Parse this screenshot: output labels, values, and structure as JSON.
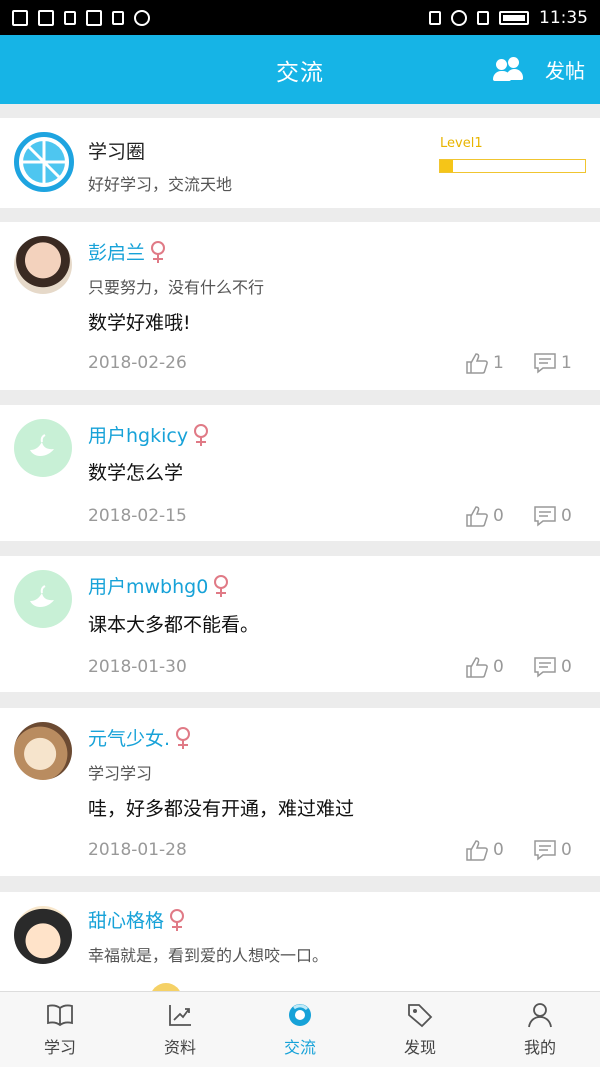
{
  "status_bar": {
    "time": "11:35"
  },
  "header": {
    "title": "交流",
    "post_label": "发帖"
  },
  "circle": {
    "name": "学习圈",
    "desc": "好好学习，交流天地",
    "level": "Level1",
    "level_progress": 0.09
  },
  "posts": [
    {
      "username": "彭启兰",
      "signature": "只要努力，没有什么不行",
      "content": "数学好难哦!",
      "date": "2018-02-26",
      "likes": "1",
      "comments": "1"
    },
    {
      "username": "用户hgkicy",
      "signature": "",
      "content": "数学怎么学",
      "date": "2018-02-15",
      "likes": "0",
      "comments": "0"
    },
    {
      "username": "用户mwbhg0",
      "signature": "",
      "content": "课本大多都不能看。",
      "date": "2018-01-30",
      "likes": "0",
      "comments": "0"
    },
    {
      "username": "元气少女.",
      "signature": "学习学习",
      "content": "哇，好多都没有开通，难过难过",
      "date": "2018-01-28",
      "likes": "0",
      "comments": "0"
    },
    {
      "username": "甜心格格",
      "signature": "幸福就是，看到爱的人想咬一口。",
      "content": "",
      "date": "",
      "likes": "",
      "comments": ""
    }
  ],
  "nav": [
    {
      "label": "学习",
      "icon": "book-icon"
    },
    {
      "label": "资料",
      "icon": "chart-icon"
    },
    {
      "label": "交流",
      "icon": "chat-circle-icon"
    },
    {
      "label": "发现",
      "icon": "tag-icon"
    },
    {
      "label": "我的",
      "icon": "user-icon"
    }
  ],
  "colors": {
    "primary": "#16b4e6",
    "accent_text": "#17a2d8",
    "level": "#f5c518",
    "female": "#e07a86"
  }
}
